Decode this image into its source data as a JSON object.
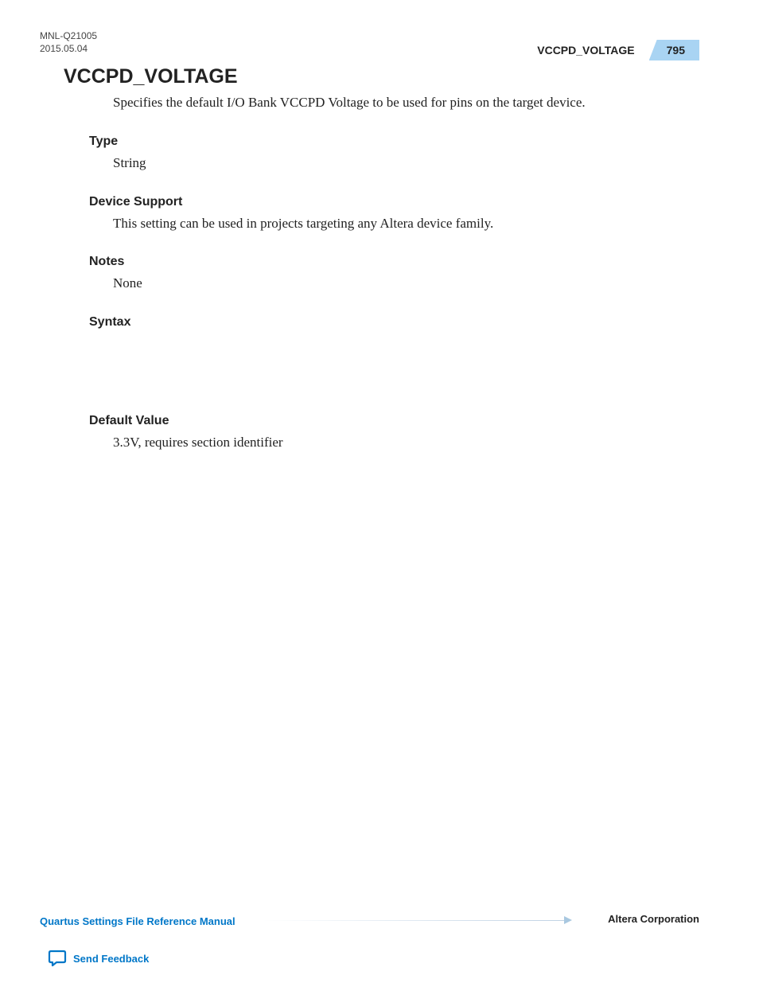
{
  "header": {
    "doc_id_line1": "MNL-Q21005",
    "doc_id_line2": "2015.05.04",
    "topic": "VCCPD_VOLTAGE",
    "page_number": "795"
  },
  "title": "VCCPD_VOLTAGE",
  "intro": "Specifies the default I/O Bank VCCPD Voltage to be used for pins on the target device.",
  "sections": {
    "type": {
      "heading": "Type",
      "body": "String"
    },
    "device_support": {
      "heading": "Device Support",
      "body": "This setting can be used in projects targeting any Altera device family."
    },
    "notes": {
      "heading": "Notes",
      "body": "None"
    },
    "syntax": {
      "heading": "Syntax"
    },
    "default_value": {
      "heading": "Default Value",
      "body": "3.3V, requires section identifier"
    }
  },
  "footer": {
    "manual": "Quartus Settings File Reference Manual",
    "company": "Altera Corporation",
    "feedback": "Send Feedback"
  }
}
